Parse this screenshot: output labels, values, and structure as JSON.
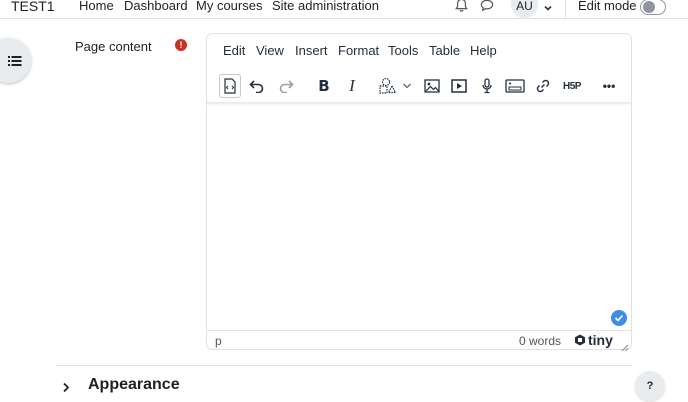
{
  "navbar": {
    "site_name": "TEST1",
    "links": [
      "Home",
      "Dashboard",
      "My courses",
      "Site administration"
    ],
    "notifications_icon": "bell-icon",
    "messages_icon": "chat-bubble-icon",
    "user_initials": "AU",
    "edit_mode_label": "Edit mode",
    "edit_mode_on": false
  },
  "form": {
    "field_label": "Page content",
    "required_icon": "!"
  },
  "editor": {
    "menu": [
      "Edit",
      "View",
      "Insert",
      "Format",
      "Tools",
      "Table",
      "Help"
    ],
    "toolbar": {
      "bold": "B",
      "italic": "I",
      "h5p": "H5P",
      "more": "•••"
    },
    "status_path": "p",
    "word_count": "0 words",
    "brand": "tiny"
  },
  "section": {
    "title": "Appearance"
  },
  "help_label": "?",
  "colors": {
    "accent": "#3d8ce6",
    "required": "#ca3120",
    "text": "#1d2125"
  }
}
